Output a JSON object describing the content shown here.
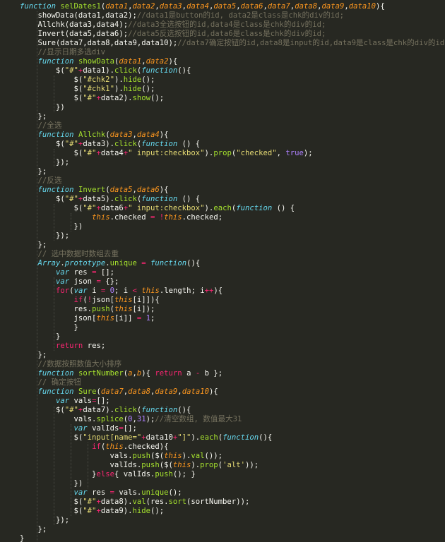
{
  "editor": {
    "theme": {
      "background": "#272822",
      "keyword": "#66d9ef",
      "function_name": "#a6e22e",
      "parameter": "#fd971f",
      "string": "#e6db74",
      "number": "#ae81ff",
      "comment": "#75715e",
      "operator": "#f92672",
      "text": "#f8f8f2"
    },
    "lines": [
      [
        [
          "kw",
          "function"
        ],
        [
          "plain",
          " "
        ],
        [
          "fn",
          "selDates1"
        ],
        [
          "plain",
          "("
        ],
        [
          "prm",
          "data1"
        ],
        [
          "plain",
          ","
        ],
        [
          "prm",
          "data2"
        ],
        [
          "plain",
          ","
        ],
        [
          "prm",
          "data3"
        ],
        [
          "plain",
          ","
        ],
        [
          "prm",
          "data4"
        ],
        [
          "plain",
          ","
        ],
        [
          "prm",
          "data5"
        ],
        [
          "plain",
          ","
        ],
        [
          "prm",
          "data6"
        ],
        [
          "plain",
          ","
        ],
        [
          "prm",
          "data7"
        ],
        [
          "plain",
          ","
        ],
        [
          "prm",
          "data8"
        ],
        [
          "plain",
          ","
        ],
        [
          "prm",
          "data9"
        ],
        [
          "plain",
          ","
        ],
        [
          "prm",
          "data10"
        ],
        [
          "plain",
          "){"
        ]
      ],
      [
        [
          "plain",
          "    showData(data1,data2);"
        ],
        [
          "cm",
          "//data1是button的id, data2是class是chk的div的id;"
        ]
      ],
      [
        [
          "plain",
          "    Allchk(data3,data4);"
        ],
        [
          "cm",
          "//data3全选按钮的id,data4是class是chk的div的id;"
        ]
      ],
      [
        [
          "plain",
          "    Invert(data5,data6);"
        ],
        [
          "cm",
          "//data5反选按钮的id,data6是class是chk的div的id;"
        ]
      ],
      [
        [
          "plain",
          "    Sure(data7,data8,data9,data10);"
        ],
        [
          "cm",
          "//data7确定按钮的id,data8是input的id,data9是class是chk的div的id,da"
        ]
      ],
      [
        [
          "cm",
          "    //显示日期多选div"
        ]
      ],
      [
        [
          "plain",
          "    "
        ],
        [
          "kw",
          "function"
        ],
        [
          "plain",
          " "
        ],
        [
          "fn",
          "showData"
        ],
        [
          "plain",
          "("
        ],
        [
          "prm",
          "data1"
        ],
        [
          "plain",
          ","
        ],
        [
          "prm",
          "data2"
        ],
        [
          "plain",
          "){"
        ]
      ],
      [
        [
          "plain",
          "        $("
        ],
        [
          "str",
          "\"#\""
        ],
        [
          "op",
          "+"
        ],
        [
          "plain",
          "data1)."
        ],
        [
          "fn",
          "click"
        ],
        [
          "plain",
          "("
        ],
        [
          "kw",
          "function"
        ],
        [
          "plain",
          "(){"
        ]
      ],
      [
        [
          "plain",
          "            $("
        ],
        [
          "str",
          "\"#chk2\""
        ],
        [
          "plain",
          ")."
        ],
        [
          "fn",
          "hide"
        ],
        [
          "plain",
          "();"
        ]
      ],
      [
        [
          "plain",
          "            $("
        ],
        [
          "str",
          "\"#chk1\""
        ],
        [
          "plain",
          ")."
        ],
        [
          "fn",
          "hide"
        ],
        [
          "plain",
          "();"
        ]
      ],
      [
        [
          "plain",
          "            $("
        ],
        [
          "str",
          "\"#\""
        ],
        [
          "op",
          "+"
        ],
        [
          "plain",
          "data2)."
        ],
        [
          "fn",
          "show"
        ],
        [
          "plain",
          "();"
        ]
      ],
      [
        [
          "plain",
          "        })"
        ]
      ],
      [
        [
          "plain",
          "    };"
        ]
      ],
      [
        [
          "cm",
          "    //全选"
        ]
      ],
      [
        [
          "plain",
          "    "
        ],
        [
          "kw",
          "function"
        ],
        [
          "plain",
          " "
        ],
        [
          "fn",
          "Allchk"
        ],
        [
          "plain",
          "("
        ],
        [
          "prm",
          "data3"
        ],
        [
          "plain",
          ","
        ],
        [
          "prm",
          "data4"
        ],
        [
          "plain",
          "){"
        ]
      ],
      [
        [
          "plain",
          "        $("
        ],
        [
          "str",
          "\"#\""
        ],
        [
          "op",
          "+"
        ],
        [
          "plain",
          "data3)."
        ],
        [
          "fn",
          "click"
        ],
        [
          "plain",
          "("
        ],
        [
          "kw",
          "function"
        ],
        [
          "plain",
          " () {"
        ]
      ],
      [
        [
          "plain",
          "            $("
        ],
        [
          "str",
          "\"#\""
        ],
        [
          "op",
          "+"
        ],
        [
          "plain",
          "data4"
        ],
        [
          "op",
          "+"
        ],
        [
          "str",
          "\" input:checkbox\""
        ],
        [
          "plain",
          ")."
        ],
        [
          "fn",
          "prop"
        ],
        [
          "plain",
          "("
        ],
        [
          "str",
          "\"checked\""
        ],
        [
          "plain",
          ", "
        ],
        [
          "num",
          "true"
        ],
        [
          "plain",
          ");"
        ]
      ],
      [
        [
          "plain",
          "        });"
        ]
      ],
      [
        [
          "plain",
          "    };"
        ]
      ],
      [
        [
          "cm",
          "    //反选"
        ]
      ],
      [
        [
          "plain",
          "    "
        ],
        [
          "kw",
          "function"
        ],
        [
          "plain",
          " "
        ],
        [
          "fn",
          "Invert"
        ],
        [
          "plain",
          "("
        ],
        [
          "prm",
          "data5"
        ],
        [
          "plain",
          ","
        ],
        [
          "prm",
          "data6"
        ],
        [
          "plain",
          "){"
        ]
      ],
      [
        [
          "plain",
          "        $("
        ],
        [
          "str",
          "\"#\""
        ],
        [
          "op",
          "+"
        ],
        [
          "plain",
          "data5)."
        ],
        [
          "fn",
          "click"
        ],
        [
          "plain",
          "("
        ],
        [
          "kw",
          "function"
        ],
        [
          "plain",
          " () {"
        ]
      ],
      [
        [
          "plain",
          "            $("
        ],
        [
          "str",
          "\"#\""
        ],
        [
          "op",
          "+"
        ],
        [
          "plain",
          "data6"
        ],
        [
          "op",
          "+"
        ],
        [
          "str",
          "\" input:checkbox\""
        ],
        [
          "plain",
          ")."
        ],
        [
          "fn",
          "each"
        ],
        [
          "plain",
          "("
        ],
        [
          "kw",
          "function"
        ],
        [
          "plain",
          " () {"
        ]
      ],
      [
        [
          "plain",
          "                "
        ],
        [
          "thisk",
          "this"
        ],
        [
          "plain",
          ".checked "
        ],
        [
          "op",
          "="
        ],
        [
          "plain",
          " "
        ],
        [
          "op",
          "!"
        ],
        [
          "thisk",
          "this"
        ],
        [
          "plain",
          ".checked;"
        ]
      ],
      [
        [
          "plain",
          "            })"
        ]
      ],
      [
        [
          "plain",
          "        });"
        ]
      ],
      [
        [
          "plain",
          "    };"
        ]
      ],
      [
        [
          "cm",
          "    // 选中数据时数组去重"
        ]
      ],
      [
        [
          "plain",
          "    "
        ],
        [
          "kw",
          "Array"
        ],
        [
          "plain",
          "."
        ],
        [
          "kw",
          "prototype"
        ],
        [
          "plain",
          "."
        ],
        [
          "fn",
          "unique"
        ],
        [
          "plain",
          " "
        ],
        [
          "op",
          "="
        ],
        [
          "plain",
          " "
        ],
        [
          "kw",
          "function"
        ],
        [
          "plain",
          "(){"
        ]
      ],
      [
        [
          "plain",
          "        "
        ],
        [
          "kw",
          "var"
        ],
        [
          "plain",
          " res "
        ],
        [
          "op",
          "="
        ],
        [
          "plain",
          " [];"
        ]
      ],
      [
        [
          "plain",
          "        "
        ],
        [
          "kw",
          "var"
        ],
        [
          "plain",
          " json "
        ],
        [
          "op",
          "="
        ],
        [
          "plain",
          " {};"
        ]
      ],
      [
        [
          "plain",
          "        "
        ],
        [
          "op",
          "for"
        ],
        [
          "plain",
          "("
        ],
        [
          "kw",
          "var"
        ],
        [
          "plain",
          " i "
        ],
        [
          "op",
          "="
        ],
        [
          "plain",
          " "
        ],
        [
          "num",
          "0"
        ],
        [
          "plain",
          "; i "
        ],
        [
          "op",
          "<"
        ],
        [
          "plain",
          " "
        ],
        [
          "thisk",
          "this"
        ],
        [
          "plain",
          ".length; i"
        ],
        [
          "op",
          "++"
        ],
        [
          "plain",
          "){"
        ]
      ],
      [
        [
          "plain",
          "            "
        ],
        [
          "op",
          "if"
        ],
        [
          "plain",
          "("
        ],
        [
          "op",
          "!"
        ],
        [
          "plain",
          "json["
        ],
        [
          "thisk",
          "this"
        ],
        [
          "plain",
          "[i]]){"
        ]
      ],
      [
        [
          "plain",
          "            res."
        ],
        [
          "fn",
          "push"
        ],
        [
          "plain",
          "("
        ],
        [
          "thisk",
          "this"
        ],
        [
          "plain",
          "[i]);"
        ]
      ],
      [
        [
          "plain",
          "            json["
        ],
        [
          "thisk",
          "this"
        ],
        [
          "plain",
          "[i]] "
        ],
        [
          "op",
          "="
        ],
        [
          "plain",
          " "
        ],
        [
          "num",
          "1"
        ],
        [
          "plain",
          ";"
        ]
      ],
      [
        [
          "plain",
          "            }"
        ]
      ],
      [
        [
          "plain",
          "        }"
        ]
      ],
      [
        [
          "plain",
          "        "
        ],
        [
          "op",
          "return"
        ],
        [
          "plain",
          " res;"
        ]
      ],
      [
        [
          "plain",
          "    };"
        ]
      ],
      [
        [
          "cm",
          "    //数据按照数值大小排序"
        ]
      ],
      [
        [
          "plain",
          "    "
        ],
        [
          "kw",
          "function"
        ],
        [
          "plain",
          " "
        ],
        [
          "fn",
          "sortNumber"
        ],
        [
          "plain",
          "("
        ],
        [
          "prm",
          "a"
        ],
        [
          "plain",
          ","
        ],
        [
          "prm",
          "b"
        ],
        [
          "plain",
          "){ "
        ],
        [
          "op",
          "return"
        ],
        [
          "plain",
          " a "
        ],
        [
          "op",
          "-"
        ],
        [
          "plain",
          " b };"
        ]
      ],
      [
        [
          "cm",
          "    // 确定按钮"
        ]
      ],
      [
        [
          "plain",
          "    "
        ],
        [
          "kw",
          "function"
        ],
        [
          "plain",
          " "
        ],
        [
          "fn",
          "Sure"
        ],
        [
          "plain",
          "("
        ],
        [
          "prm",
          "data7"
        ],
        [
          "plain",
          ","
        ],
        [
          "prm",
          "data8"
        ],
        [
          "plain",
          ","
        ],
        [
          "prm",
          "data9"
        ],
        [
          "plain",
          ","
        ],
        [
          "prm",
          "data10"
        ],
        [
          "plain",
          "){"
        ]
      ],
      [
        [
          "plain",
          "        "
        ],
        [
          "kw",
          "var"
        ],
        [
          "plain",
          " vals"
        ],
        [
          "op",
          "="
        ],
        [
          "plain",
          "[];"
        ]
      ],
      [
        [
          "plain",
          "        $("
        ],
        [
          "str",
          "\"#\""
        ],
        [
          "op",
          "+"
        ],
        [
          "plain",
          "data7)."
        ],
        [
          "fn",
          "click"
        ],
        [
          "plain",
          "("
        ],
        [
          "kw",
          "function"
        ],
        [
          "plain",
          "(){"
        ]
      ],
      [
        [
          "plain",
          "            vals."
        ],
        [
          "fn",
          "splice"
        ],
        [
          "plain",
          "("
        ],
        [
          "num",
          "0"
        ],
        [
          "plain",
          ","
        ],
        [
          "num",
          "31"
        ],
        [
          "plain",
          ");"
        ],
        [
          "cm",
          "//清空数组, 数值最大31"
        ]
      ],
      [
        [
          "plain",
          "            "
        ],
        [
          "kw",
          "var"
        ],
        [
          "plain",
          " valIds"
        ],
        [
          "op",
          "="
        ],
        [
          "plain",
          "[];"
        ]
      ],
      [
        [
          "plain",
          "            $("
        ],
        [
          "str",
          "\"input[name=\""
        ],
        [
          "op",
          "+"
        ],
        [
          "plain",
          "data10"
        ],
        [
          "op",
          "+"
        ],
        [
          "str",
          "\"]\""
        ],
        [
          "plain",
          ")."
        ],
        [
          "fn",
          "each"
        ],
        [
          "plain",
          "("
        ],
        [
          "kw",
          "function"
        ],
        [
          "plain",
          "(){"
        ]
      ],
      [
        [
          "plain",
          "                "
        ],
        [
          "op",
          "if"
        ],
        [
          "plain",
          "("
        ],
        [
          "thisk",
          "this"
        ],
        [
          "plain",
          ".checked){"
        ]
      ],
      [
        [
          "plain",
          "                    vals."
        ],
        [
          "fn",
          "push"
        ],
        [
          "plain",
          "($("
        ],
        [
          "thisk",
          "this"
        ],
        [
          "plain",
          ")."
        ],
        [
          "fn",
          "val"
        ],
        [
          "plain",
          "());"
        ]
      ],
      [
        [
          "plain",
          "                    valIds."
        ],
        [
          "fn",
          "push"
        ],
        [
          "plain",
          "($("
        ],
        [
          "thisk",
          "this"
        ],
        [
          "plain",
          ")."
        ],
        [
          "fn",
          "prop"
        ],
        [
          "plain",
          "("
        ],
        [
          "str",
          "'alt'"
        ],
        [
          "plain",
          "));"
        ]
      ],
      [
        [
          "plain",
          "                }"
        ],
        [
          "op",
          "else"
        ],
        [
          "plain",
          "{ valIds."
        ],
        [
          "fn",
          "push"
        ],
        [
          "plain",
          "(); }"
        ]
      ],
      [
        [
          "plain",
          "            })"
        ]
      ],
      [
        [
          "plain",
          "            "
        ],
        [
          "kw",
          "var"
        ],
        [
          "plain",
          " res "
        ],
        [
          "op",
          "="
        ],
        [
          "plain",
          " vals."
        ],
        [
          "fn",
          "unique"
        ],
        [
          "plain",
          "();"
        ]
      ],
      [
        [
          "plain",
          "            $("
        ],
        [
          "str",
          "\"#\""
        ],
        [
          "op",
          "+"
        ],
        [
          "plain",
          "data8)."
        ],
        [
          "fn",
          "val"
        ],
        [
          "plain",
          "(res."
        ],
        [
          "fn",
          "sort"
        ],
        [
          "plain",
          "(sortNumber));"
        ]
      ],
      [
        [
          "plain",
          "            $("
        ],
        [
          "str",
          "\"#\""
        ],
        [
          "op",
          "+"
        ],
        [
          "plain",
          "data9)."
        ],
        [
          "fn",
          "hide"
        ],
        [
          "plain",
          "();"
        ]
      ],
      [
        [
          "plain",
          "        });"
        ]
      ],
      [
        [
          "plain",
          "    };"
        ]
      ],
      [
        [
          "plain",
          "}"
        ]
      ]
    ]
  }
}
